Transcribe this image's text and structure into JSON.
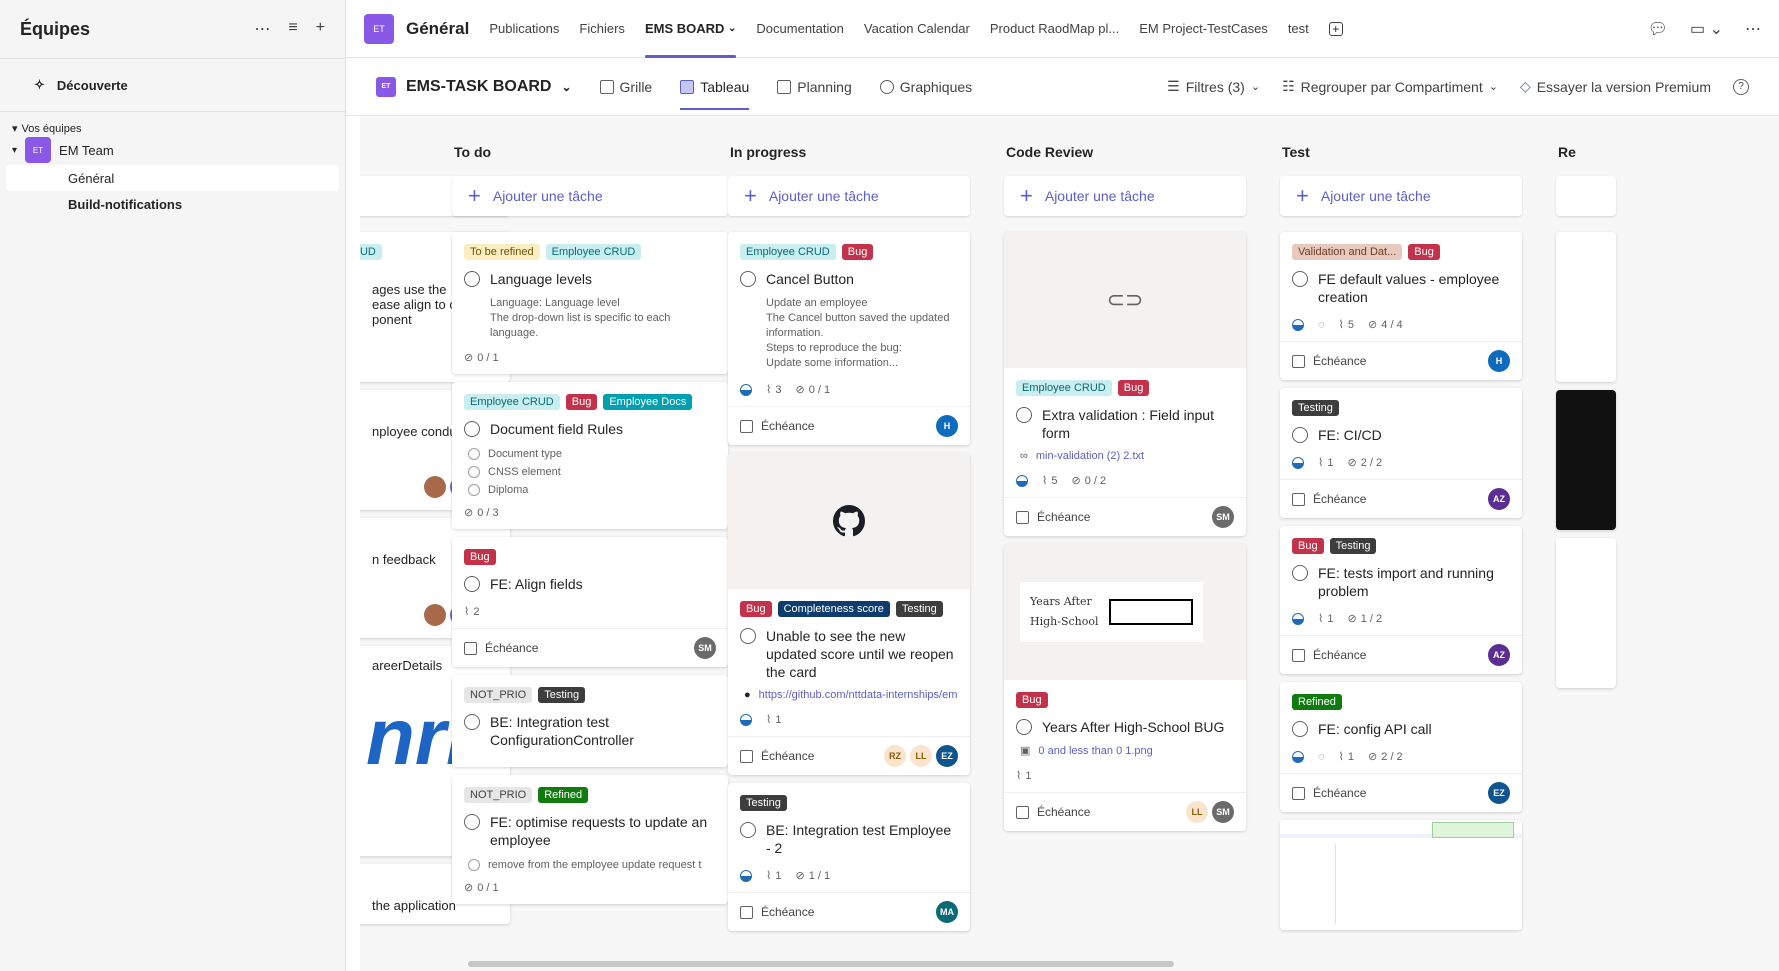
{
  "sidebar": {
    "title": "Équipes",
    "discover": "Découverte",
    "section": "Vos équipes",
    "team": {
      "initials": "ET",
      "name": "EM Team"
    },
    "channels": [
      "Général",
      "Build-notifications"
    ]
  },
  "topbar": {
    "channel_initials": "ET",
    "channel_title": "Général",
    "tabs": [
      "Publications",
      "Fichiers",
      "EMS BOARD",
      "Documentation",
      "Vacation Calendar",
      "Product RaodMap pl...",
      "EM Project-TestCases",
      "test"
    ]
  },
  "planbar": {
    "plan_initials": "ET",
    "plan_name": "EMS-TASK BOARD",
    "views": [
      "Grille",
      "Tableau",
      "Planning",
      "Graphiques"
    ],
    "filters": "Filtres (3)",
    "group": "Regrouper par Compartiment",
    "premium": "Essayer la version Premium"
  },
  "board": {
    "add_task": "Ajouter une tâche",
    "due_label": "Échéance",
    "partial": {
      "label": "RUD",
      "card1": "ages use the\nease align to one\nponent",
      "card2": "nployee conduct",
      "card3": "n feedback",
      "card4": "areerDetails",
      "card5": "the application",
      "logo_text": "nri"
    },
    "columns": {
      "todo": {
        "title": "To do",
        "cards": [
          {
            "labels": [
              "To be refined",
              "Employee CRUD"
            ],
            "title": "Language levels",
            "desc1": "Language: Language level",
            "desc2": "The drop-down list is specific to each language.",
            "checks": "0 / 1"
          },
          {
            "labels": [
              "Employee CRUD",
              "Bug",
              "Employee Docs"
            ],
            "title": "Document field Rules",
            "items": [
              "Document type",
              "CNSS element",
              "Diploma"
            ],
            "checks": "0 / 3"
          },
          {
            "labels": [
              "Bug"
            ],
            "title": "FE: Align fields",
            "attach": "2",
            "avatar": "SM"
          },
          {
            "labels": [
              "NOT_PRIO",
              "Testing"
            ],
            "title": "BE: Integration test ConfigurationController"
          },
          {
            "labels": [
              "NOT_PRIO",
              "Refined"
            ],
            "title": "FE: optimise requests to update an employee",
            "item": "remove from the employee update request t",
            "checks": "0 / 1"
          }
        ]
      },
      "progress": {
        "title": "In progress",
        "cards": [
          {
            "labels": [
              "Employee CRUD",
              "Bug"
            ],
            "title": "Cancel Button",
            "desc": "Update an employee\nThe Cancel button saved the updated information.\nSteps to reproduce the bug:\nUpdate some information...",
            "attach": "3",
            "checks": "0 / 1",
            "avatar": "H"
          },
          {
            "labels": [
              "Bug",
              "Completeness score",
              "Testing"
            ],
            "title": "Unable to see the new updated score until we reopen the card",
            "link": "https://github.com/nttdata-internships/em-f",
            "attach": "1",
            "avatars": [
              "RZ",
              "LL",
              "EZ"
            ]
          },
          {
            "labels": [
              "Testing"
            ],
            "title": "BE: Integration test Employee - 2",
            "attach": "1",
            "checks": "1 / 1",
            "avatar": "MA"
          }
        ]
      },
      "review": {
        "title": "Code Review",
        "cards": [
          {
            "labels": [
              "Employee CRUD",
              "Bug"
            ],
            "title": "Extra validation : Field input form",
            "link": "min-validation (2) 2.txt",
            "attach": "5",
            "checks": "0 / 2",
            "avatar": "SM"
          },
          {
            "labels": [
              "Bug"
            ],
            "title": "Years After High-School BUG",
            "link": "0 and less than 0 1.png",
            "attach": "1",
            "avatars": [
              "LL",
              "SM"
            ],
            "preview_text1": "Years After",
            "preview_text2": "High-School"
          }
        ]
      },
      "test": {
        "title": "Test",
        "cards": [
          {
            "labels": [
              "Validation and Dat...",
              "Bug"
            ],
            "title": "FE default values - employee creation",
            "attach": "5",
            "checks": "4 / 4",
            "avatar": "H"
          },
          {
            "labels": [
              "Testing"
            ],
            "title": "FE: CI/CD",
            "attach": "1",
            "checks": "2 / 2",
            "avatar": "AZ"
          },
          {
            "labels": [
              "Bug",
              "Testing"
            ],
            "title": "FE: tests import and running problem",
            "attach": "1",
            "checks": "1 / 2",
            "avatar": "AZ"
          },
          {
            "labels": [
              "Refined"
            ],
            "title": "FE: config API call",
            "attach": "1",
            "checks": "2 / 2",
            "avatar": "EZ"
          }
        ]
      },
      "next": {
        "title": "Re"
      }
    }
  },
  "icons": [
    "more-icon",
    "filter-icon",
    "plus-icon",
    "chat-icon",
    "video-icon",
    "help-icon",
    "github-icon",
    "link-icon",
    "calendar-icon"
  ]
}
